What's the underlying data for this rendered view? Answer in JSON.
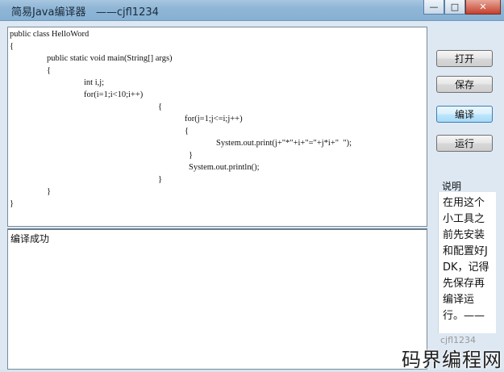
{
  "window": {
    "title": "简易Java编译器   ——cjfl1234",
    "minimize_glyph": "—",
    "maximize_glyph": "□",
    "close_glyph": "✕"
  },
  "code_lines": [
    "public class HelloWord",
    "{",
    "public static void main(String[] args)",
    "{",
    "int i,j;",
    "for(i=1;i<10;i++)",
    "{",
    "for(j=1;j<=i;j++)",
    "{",
    "System.out.print(j+\"*\"+i+\"=\"+j*i+\"  \");",
    "}",
    "System.out.println();",
    "}",
    "}",
    "}"
  ],
  "output_text": "编译成功",
  "buttons": {
    "open": "打开",
    "save": "保存",
    "compile": "编译",
    "run": "运行"
  },
  "notes": {
    "label": "说明",
    "text": "在用这个小工具之前先安装和配置好JDK，记得先保存再编译运行。——",
    "author": "cjfl1234"
  },
  "watermark": "码界编程网"
}
